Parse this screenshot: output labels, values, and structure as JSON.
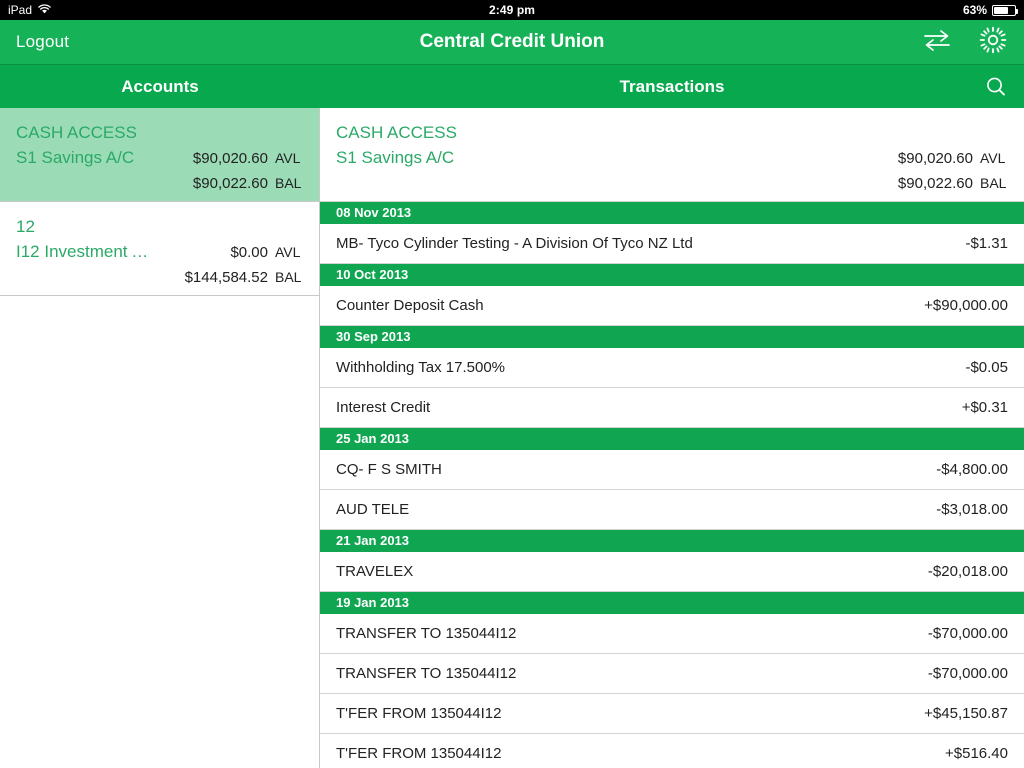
{
  "status_bar": {
    "device": "iPad",
    "wifi_icon": "wifi-icon",
    "time": "2:49 pm",
    "battery_percent": "63%",
    "battery_level": 63
  },
  "nav_bar": {
    "logout_label": "Logout",
    "title": "Central Credit Union",
    "transfer_icon": "transfer-arrows-icon",
    "settings_icon": "gear-icon"
  },
  "tab_bar": {
    "accounts_label": "Accounts",
    "transactions_label": "Transactions",
    "search_icon": "search-icon"
  },
  "accounts": [
    {
      "name": "CASH ACCESS",
      "subtitle": "S1 Savings A/C",
      "available": "$90,020.60",
      "available_tag": "AVL",
      "balance": "$90,022.60",
      "balance_tag": "BAL",
      "selected": true
    },
    {
      "name": "12",
      "subtitle": "I12 Investment A…",
      "available": "$0.00",
      "available_tag": "AVL",
      "balance": "$144,584.52",
      "balance_tag": "BAL",
      "selected": false
    }
  ],
  "detail_header": {
    "name": "CASH ACCESS",
    "subtitle": "S1 Savings A/C",
    "available": "$90,020.60",
    "available_tag": "AVL",
    "balance": "$90,022.60",
    "balance_tag": "BAL"
  },
  "transaction_groups": [
    {
      "date": "08 Nov 2013",
      "transactions": [
        {
          "description": "MB- Tyco Cylinder Testing - A Division Of Tyco NZ Ltd",
          "amount": "-$1.31"
        }
      ]
    },
    {
      "date": "10 Oct 2013",
      "transactions": [
        {
          "description": "Counter Deposit Cash",
          "amount": "+$90,000.00"
        }
      ]
    },
    {
      "date": "30 Sep 2013",
      "transactions": [
        {
          "description": "Withholding Tax  17.500%",
          "amount": "-$0.05"
        },
        {
          "description": "Interest Credit",
          "amount": "+$0.31"
        }
      ]
    },
    {
      "date": "25 Jan 2013",
      "transactions": [
        {
          "description": "CQ- F S SMITH",
          "amount": "-$4,800.00"
        },
        {
          "description": "AUD TELE",
          "amount": "-$3,018.00"
        }
      ]
    },
    {
      "date": "21 Jan 2013",
      "transactions": [
        {
          "description": "TRAVELEX",
          "amount": "-$20,018.00"
        }
      ]
    },
    {
      "date": "19 Jan 2013",
      "transactions": [
        {
          "description": "TRANSFER TO 135044I12",
          "amount": "-$70,000.00"
        },
        {
          "description": "TRANSFER TO 135044I12",
          "amount": "-$70,000.00"
        },
        {
          "description": "T'FER FROM 135044I12",
          "amount": "+$45,150.87"
        },
        {
          "description": "T'FER FROM 135044I12",
          "amount": "+$516.40"
        }
      ]
    }
  ],
  "colors": {
    "nav_green": "#16B257",
    "tab_green": "#08A94E",
    "date_green": "#10A651",
    "selected_row": "#9BDCB6",
    "account_text": "#2BA968"
  }
}
